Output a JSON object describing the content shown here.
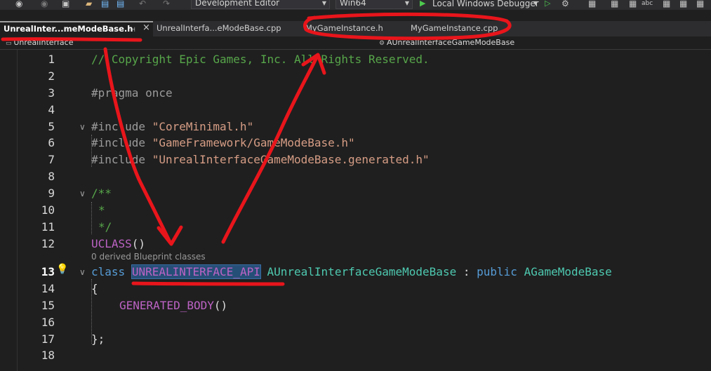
{
  "toolbar": {
    "config": "Development Editor",
    "platform": "Win64",
    "debugger": "Local Windows Debugger"
  },
  "tabs": [
    {
      "label": "UnrealInter...meModeBase.h",
      "active": true
    },
    {
      "label": "UnrealInterfa...eModeBase.cpp",
      "active": false
    },
    {
      "label": "MyGameInstance.h",
      "active": false
    },
    {
      "label": "MyGameInstance.cpp",
      "active": false
    }
  ],
  "nav": {
    "project": "UnrealInterface",
    "scope": "AUnrealInterfaceGameModeBase"
  },
  "line_numbers": [
    "1",
    "2",
    "3",
    "4",
    "5",
    "6",
    "7",
    "8",
    "9",
    "10",
    "11",
    "12",
    "13",
    "14",
    "15",
    "16",
    "17",
    "18"
  ],
  "code": {
    "l1": "// Copyright Epic Games, Inc. All Rights Reserved.",
    "l3": "#pragma once",
    "l5_kw": "#include",
    "l5_str": "\"CoreMinimal.h\"",
    "l6_kw": "#include",
    "l6_str": "\"GameFramework/GameModeBase.h\"",
    "l7_kw": "#include",
    "l7_str": "\"UnrealInterfaceGameModeBase.generated.h\"",
    "l9": "/**",
    "l10": "*",
    "l11": "*/",
    "l12_mac": "UCLASS",
    "l12_rest": "()",
    "codelens": "0 derived Blueprint classes",
    "l13_kw": "class",
    "l13_api": "UNREALINTERFACE_API",
    "l13_cls": "AUnrealInterfaceGameModeBase",
    "l13_colon": ":",
    "l13_pub": "public",
    "l13_base": "AGameModeBase",
    "l14": "{",
    "l15_mac": "GENERATED_BODY",
    "l15_rest": "()",
    "l17": "};"
  },
  "colors": {
    "annotation": "#e8151b",
    "selection": "#264f78"
  },
  "icons": [
    "back-icon",
    "forward-icon",
    "new-project-icon",
    "open-folder-icon",
    "save-icon",
    "save-all-icon",
    "undo-icon",
    "redo-icon",
    "play-icon",
    "lightbulb-icon",
    "pin-icon",
    "close-icon"
  ]
}
